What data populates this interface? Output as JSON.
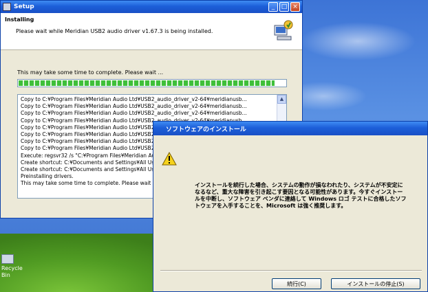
{
  "setup": {
    "title": "Setup",
    "header_title": "Installing",
    "header_subtitle": "Please wait while Meridian USB2 audio driver v1.67.3 is being installed.",
    "status": "This may take some time to complete. Please wait ...",
    "progress_fraction": 0.96,
    "log": [
      "Copy to C:¥Program Files¥Meridian Audio Ltd¥USB2_audio_driver_v2-64¥meridianusb...",
      "Copy to C:¥Program Files¥Meridian Audio Ltd¥USB2_audio_driver_v2-64¥meridianusb...",
      "Copy to C:¥Program Files¥Meridian Audio Ltd¥USB2_audio_driver_v2-64¥meridianusb...",
      "Copy to C:¥Program Files¥Meridian Audio Ltd¥USB2_audio_driver_v2-64¥meridianusb...",
      "Copy to C:¥Program Files¥Meridian Audio Ltd¥USB2_audio_driver_v2-64¥meridianusb...",
      "Copy to C:¥Program Files¥Meridian Audio Ltd¥USB2_audio_driver_v2-64¥meridianusb...",
      "Copy to C:¥Program Files¥Meridian Audio Ltd¥USB2_audio_driver_v2-64¥meridianusb...",
      "Copy to C:¥Program Files¥Meridian Audio Ltd¥USB2_audio_driver_v2-64¥meridianusb...",
      "Execute: regsvr32 /s \"C:¥Program Files¥Meridian Audio Ltd¥USB2_audio_driver_v2-64¥...",
      "Create shortcut: C:¥Documents and Settings¥All Users¥Start Menu¥Programs¥Meridian...",
      "Create shortcut: C:¥Documents and Settings¥All Users¥Start Menu¥Programs¥Meridian...",
      "Preinstalling drivers.",
      "This may take some time to complete. Please wait ..."
    ],
    "window_buttons": {
      "minimize": "_",
      "maximize": "□",
      "close": "×"
    }
  },
  "dialog": {
    "title": "ソフトウェアのインストール",
    "message": "インストールを続行した場合、システムの動作が損なわれたり、システムが不安定になるなど、重大な障害を引き起こす要因となる可能性があります。今すぐインストールを中断し、ソフトウェア ベンダに連絡して Windows ロゴ テストに合格したソフトウェアを入手することを、Microsoft は強く推奨します。",
    "continue_button": "続行(C)",
    "stop_button": "インストールの停止(S)"
  },
  "desktop": {
    "icon_label": "Recycle Bin"
  },
  "colors": {
    "titlebar": "#1c5fd9",
    "progress": "#3fbf3a",
    "window_bg": "#ece9d8"
  }
}
